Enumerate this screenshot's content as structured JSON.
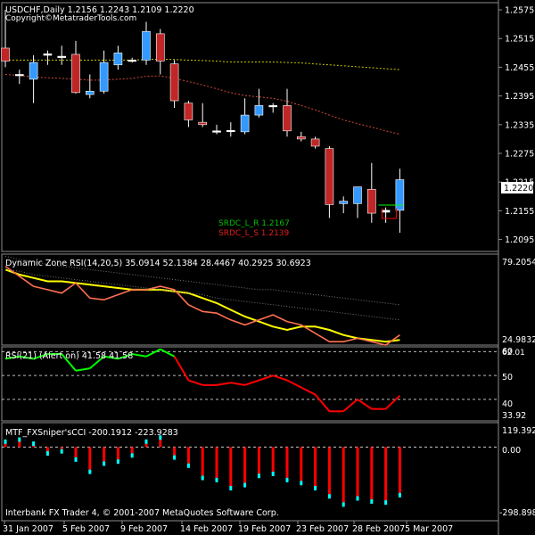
{
  "colors": {
    "background": "#000000",
    "frame": "#8c8c8c",
    "bull": "#3399ff",
    "bear": "#c02626",
    "doji": "#ffffff",
    "ma_fast": "#d04a3a",
    "ma_slow": "#c8c800",
    "rsi_main": "#ffff00",
    "rsi_signal": "#ff7050",
    "rsi_up": "#00ff00",
    "rsi_down": "#ff0000",
    "cci_up": "#00ffff",
    "cci_down": "#ff0000",
    "srdc_r": "#00ff00",
    "srdc_s": "#ff0000"
  },
  "main_panel": {
    "header": "USDCHF,Daily  1.2156 1.2243 1.2109 1.2220",
    "copyright": "Copyright©MetatraderTools.com",
    "price_labels": [
      "1.2575",
      "1.2515",
      "1.2455",
      "1.2395",
      "1.2335",
      "1.2275",
      "1.2215",
      "1.2155",
      "1.2095"
    ],
    "current_price": "1.2220",
    "srdc_r": "SRDC_L_R   1.2167",
    "srdc_s": "SRDC_L_S   1.2139"
  },
  "rsi_panel": {
    "header": "Dynamic Zone RSI(14,20,5) 35.0914 52.1384 28.4467 40.2925 30.6923",
    "max_label": "79.2054",
    "min_label": "24.9832"
  },
  "rsi21_panel": {
    "header": "RSI(21) (Alert on) 41.58 41.58",
    "labels": [
      "60",
      "50",
      "40",
      "33.92"
    ],
    "top_label": "62.01"
  },
  "cci_panel": {
    "header": "MTF_FXSniper'sCCI   -200.1912 -223.9283",
    "max_label": "119.3927",
    "zero_label": "0.00",
    "min_label": "-298.8987",
    "footer": "Interbank FX Trader 4, © 2001-2007 MetaQuotes Software Corp."
  },
  "time_axis": [
    "31 Jan 2007",
    "5 Feb 2007",
    "9 Feb 2007",
    "14 Feb 2007",
    "19 Feb 2007",
    "23 Feb 2007",
    "28 Feb 2007",
    "5 Mar 2007"
  ],
  "chart_data": [
    {
      "type": "candlestick",
      "title": "USDCHF,Daily",
      "ylim": [
        1.207,
        1.259
      ],
      "ticks": [
        1.2575,
        1.2515,
        1.2455,
        1.2395,
        1.2335,
        1.2275,
        1.2215,
        1.2155,
        1.2095
      ],
      "candles": [
        {
          "o": 1.2495,
          "h": 1.2575,
          "l": 1.2455,
          "c": 1.2468
        },
        {
          "o": 1.244,
          "h": 1.245,
          "l": 1.242,
          "c": 1.244
        },
        {
          "o": 1.243,
          "h": 1.248,
          "l": 1.238,
          "c": 1.2465
        },
        {
          "o": 1.2483,
          "h": 1.249,
          "l": 1.246,
          "c": 1.248
        },
        {
          "o": 1.2478,
          "h": 1.25,
          "l": 1.246,
          "c": 1.2478
        },
        {
          "o": 1.2482,
          "h": 1.251,
          "l": 1.24,
          "c": 1.2402
        },
        {
          "o": 1.2398,
          "h": 1.244,
          "l": 1.239,
          "c": 1.2405
        },
        {
          "o": 1.2405,
          "h": 1.249,
          "l": 1.24,
          "c": 1.2465
        },
        {
          "o": 1.246,
          "h": 1.25,
          "l": 1.245,
          "c": 1.2485
        },
        {
          "o": 1.247,
          "h": 1.2475,
          "l": 1.2465,
          "c": 1.247
        },
        {
          "o": 1.247,
          "h": 1.255,
          "l": 1.246,
          "c": 1.253
        },
        {
          "o": 1.2525,
          "h": 1.2535,
          "l": 1.244,
          "c": 1.2468
        },
        {
          "o": 1.2462,
          "h": 1.247,
          "l": 1.237,
          "c": 1.2385
        },
        {
          "o": 1.238,
          "h": 1.2385,
          "l": 1.233,
          "c": 1.2345
        },
        {
          "o": 1.234,
          "h": 1.238,
          "l": 1.233,
          "c": 1.2335
        },
        {
          "o": 1.2322,
          "h": 1.2335,
          "l": 1.2315,
          "c": 1.2322
        },
        {
          "o": 1.2323,
          "h": 1.234,
          "l": 1.231,
          "c": 1.2323
        },
        {
          "o": 1.232,
          "h": 1.239,
          "l": 1.2315,
          "c": 1.2355
        },
        {
          "o": 1.2355,
          "h": 1.241,
          "l": 1.235,
          "c": 1.2375
        },
        {
          "o": 1.2375,
          "h": 1.238,
          "l": 1.236,
          "c": 1.2375
        },
        {
          "o": 1.2375,
          "h": 1.241,
          "l": 1.231,
          "c": 1.2322
        },
        {
          "o": 1.231,
          "h": 1.232,
          "l": 1.23,
          "c": 1.2305
        },
        {
          "o": 1.2305,
          "h": 1.231,
          "l": 1.2285,
          "c": 1.229
        },
        {
          "o": 1.2285,
          "h": 1.229,
          "l": 1.214,
          "c": 1.2168
        },
        {
          "o": 1.217,
          "h": 1.2185,
          "l": 1.215,
          "c": 1.2175
        },
        {
          "o": 1.217,
          "h": 1.22,
          "l": 1.214,
          "c": 1.2205
        },
        {
          "o": 1.22,
          "h": 1.2255,
          "l": 1.213,
          "c": 1.215
        },
        {
          "o": 1.2152,
          "h": 1.2162,
          "l": 1.213,
          "c": 1.2156
        },
        {
          "o": 1.2156,
          "h": 1.2243,
          "l": 1.2109,
          "c": 1.222
        }
      ],
      "ma_fast": [
        1.244,
        1.2438,
        1.2435,
        1.2433,
        1.2432,
        1.243,
        1.2428,
        1.2428,
        1.243,
        1.2432,
        1.2436,
        1.2437,
        1.2432,
        1.2425,
        1.2418,
        1.241,
        1.2402,
        1.2396,
        1.2393,
        1.239,
        1.2384,
        1.2375,
        1.2366,
        1.2355,
        1.2345,
        1.2337,
        1.233,
        1.2322,
        1.2315
      ],
      "ma_slow": [
        1.247,
        1.247,
        1.247,
        1.247,
        1.247,
        1.247,
        1.247,
        1.247,
        1.247,
        1.247,
        1.2471,
        1.2472,
        1.2471,
        1.247,
        1.2469,
        1.2468,
        1.2466,
        1.2466,
        1.2466,
        1.2466,
        1.2465,
        1.2464,
        1.2462,
        1.246,
        1.2458,
        1.2456,
        1.2454,
        1.2452,
        1.245
      ]
    },
    {
      "type": "line",
      "title": "Dynamic Zone RSI(14,20,5)",
      "ylim": [
        24.9832,
        79.2054
      ],
      "series": [
        {
          "name": "rsi",
          "values": [
            70,
            67,
            65,
            63,
            63,
            62,
            61,
            60,
            59,
            58,
            58,
            58,
            57,
            56,
            53,
            50,
            46,
            42,
            39,
            36,
            34,
            36,
            36,
            34,
            31,
            29,
            28,
            27,
            28
          ]
        },
        {
          "name": "signal",
          "values": [
            72,
            66,
            60,
            58,
            56,
            62,
            53,
            52,
            55,
            58,
            58,
            60,
            58,
            49,
            45,
            44,
            40,
            37,
            40,
            43,
            39,
            37,
            32,
            27,
            27,
            29,
            27,
            25,
            31
          ]
        },
        {
          "name": "upper",
          "values": [
            78,
            76,
            75,
            73,
            72,
            71,
            70,
            69,
            68,
            67,
            66,
            65,
            64,
            63,
            62,
            61,
            60,
            59,
            58,
            58,
            57,
            56,
            55,
            54,
            53,
            52,
            51,
            50,
            49
          ]
        },
        {
          "name": "lower",
          "values": [
            70,
            69,
            67,
            66,
            65,
            64,
            63,
            62,
            61,
            60,
            59,
            58,
            57,
            56,
            55,
            53,
            52,
            51,
            50,
            49,
            48,
            47,
            46,
            45,
            44,
            43,
            42,
            41,
            40
          ]
        }
      ]
    },
    {
      "type": "line",
      "title": "RSI(21) (Alert on)",
      "ylim": [
        31,
        62.01
      ],
      "levels": [
        60,
        50,
        40
      ],
      "values": [
        57,
        58,
        57,
        59,
        59,
        52,
        53,
        58,
        57,
        59,
        58,
        61,
        58,
        48,
        46,
        46,
        47,
        46,
        48,
        50,
        48,
        45,
        42,
        35,
        35,
        40,
        36,
        36,
        41.58
      ]
    },
    {
      "type": "bar",
      "title": "MTF_FXSniper'sCCI",
      "ylim": [
        -298.8987,
        119.3927
      ],
      "values": [
        20,
        30,
        10,
        -20,
        -10,
        -50,
        -110,
        -70,
        -60,
        -30,
        20,
        40,
        -40,
        -80,
        -140,
        -150,
        -190,
        -175,
        -130,
        -120,
        -150,
        -165,
        -190,
        -230,
        -270,
        -240,
        -255,
        -260,
        -224
      ]
    }
  ]
}
